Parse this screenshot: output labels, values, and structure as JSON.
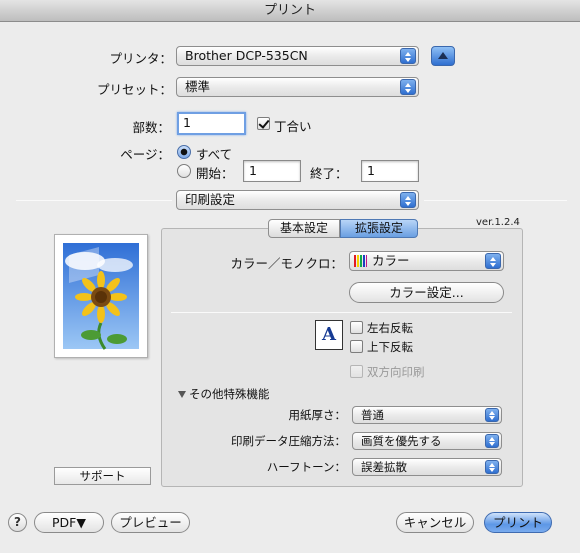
{
  "window": {
    "title": "プリント"
  },
  "printer": {
    "label": "プリンタ：",
    "value": "Brother DCP-535CN"
  },
  "preset": {
    "label": "プリセット：",
    "value": "標準"
  },
  "copies": {
    "label": "部数：",
    "value": "1",
    "collate_label": "丁合い",
    "collate_checked": true
  },
  "pages": {
    "label": "ページ：",
    "all_label": "すべて",
    "from_label": "開始：",
    "from_value": "1",
    "to_label": "終了：",
    "to_value": "1",
    "selected": "all"
  },
  "panel_menu": {
    "value": "印刷設定"
  },
  "tabs": [
    {
      "label": "基本設定",
      "selected": false
    },
    {
      "label": "拡張設定",
      "selected": true
    }
  ],
  "version": "ver.1.2.4",
  "color_mode": {
    "label": "カラー／モノクロ：",
    "value": "カラー"
  },
  "color_settings_button": "カラー設定...",
  "page_icon_letter": "A",
  "mirror_label": "左右反転",
  "flip_label": "上下反転",
  "bidirectional_label": "双方向印刷",
  "other_features": {
    "heading": "その他特殊機能",
    "paper_thickness": {
      "label": "用紙厚さ：",
      "value": "普通"
    },
    "compression": {
      "label": "印刷データ圧縮方法：",
      "value": "画質を優先する"
    },
    "halftone": {
      "label": "ハーフトーン：",
      "value": "誤差拡散"
    }
  },
  "support_button": "サポート",
  "footer": {
    "help": "?",
    "pdf_button": "PDF▼",
    "preview_button": "プレビュー",
    "cancel_button": "キャンセル",
    "print_button": "プリント"
  },
  "colors": {
    "accent": "#3f7ad8",
    "window_bg": "#ececec",
    "pane_bg": "#e4e4e4"
  }
}
